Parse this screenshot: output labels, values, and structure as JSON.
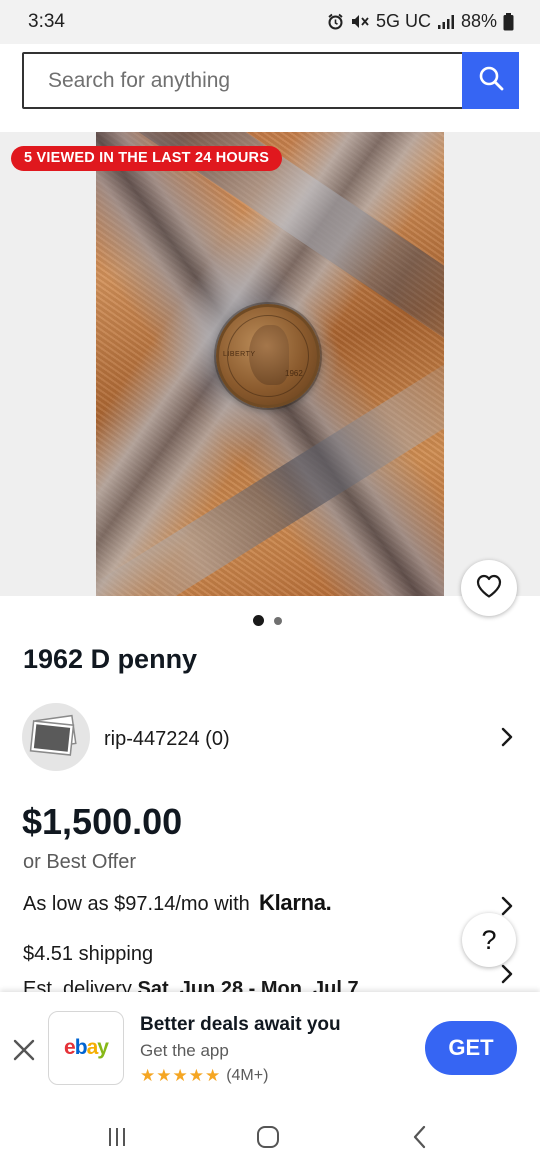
{
  "status_bar": {
    "time": "3:34",
    "network": "5G UC",
    "battery": "88%",
    "icons": [
      "alarm-icon",
      "mute-icon",
      "signal-icon",
      "battery-icon"
    ]
  },
  "search": {
    "placeholder": "Search for anything",
    "value": "",
    "button_icon": "search-icon"
  },
  "gallery": {
    "badge": "5 VIEWED IN THE LAST 24 HOURS",
    "coin_text": {
      "liberty": "LIBERTY",
      "year": "1962"
    },
    "image_count": 2,
    "active_index": 0,
    "heart_icon": "heart-icon"
  },
  "item": {
    "title": "1962 D penny",
    "seller": "rip-447224 (0)",
    "price": "$1,500.00",
    "best_offer": "or Best Offer",
    "financing": "As low as $97.14/mo with",
    "financing_brand": "Klarna.",
    "shipping": "$4.51 shipping",
    "delivery_prefix": "Est. delivery",
    "delivery_dates": "Sat, Jun 28 - Mon, Jul 7"
  },
  "help": {
    "label": "?"
  },
  "app_banner": {
    "logo_letters": [
      "e",
      "b",
      "a",
      "y"
    ],
    "title": "Better deals await you",
    "subtitle": "Get the app",
    "stars": "★★★★★",
    "rating_count": "(4M+)",
    "button": "GET"
  },
  "colors": {
    "accent": "#3665f3",
    "badge": "#e0181e",
    "ebay_e": "#e53238",
    "ebay_b": "#0064d2",
    "ebay_a": "#f5af02",
    "ebay_y": "#86b817",
    "stars": "#f5a623"
  }
}
